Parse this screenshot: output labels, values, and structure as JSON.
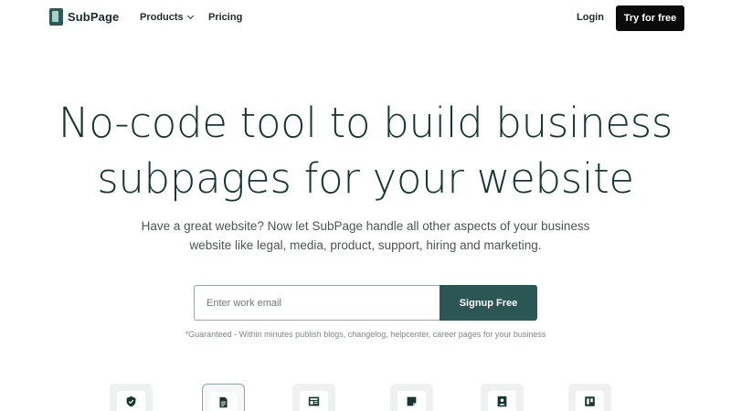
{
  "brand": {
    "name": "SubPage"
  },
  "nav": {
    "products": "Products",
    "pricing": "Pricing",
    "login": "Login",
    "try": "Try for free"
  },
  "hero": {
    "title_line1": "No-code tool to build business",
    "title_line2": "subpages for your website",
    "subtitle_line1": "Have a great website? Now let SubPage handle all other aspects of your business",
    "subtitle_line2": "website like legal, media, product, support, hiring and marketing."
  },
  "signup": {
    "placeholder": "Enter work email",
    "button": "Signup Free",
    "note": "*Guaranteed - Within minutes publish blogs, changelog, helpcenter, career pages for your business"
  },
  "tiles": [
    {
      "icon": "shield-icon"
    },
    {
      "icon": "document-icon",
      "active": true
    },
    {
      "icon": "newspaper-icon"
    },
    {
      "icon": "note-icon"
    },
    {
      "icon": "contact-card-icon"
    },
    {
      "icon": "board-icon"
    }
  ],
  "colors": {
    "accent": "#2c5654",
    "title": "#16362f",
    "cta": "#0b0b0b"
  }
}
